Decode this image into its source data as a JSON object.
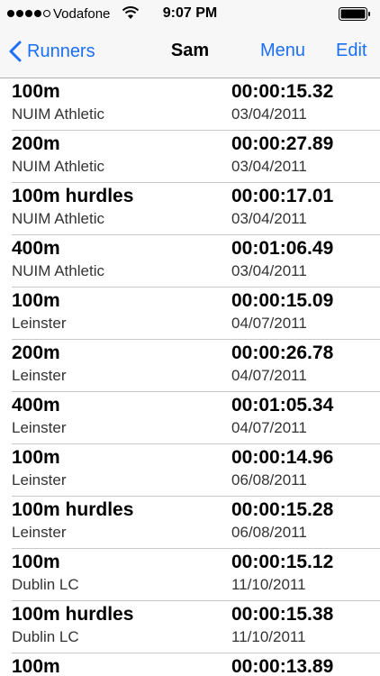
{
  "status_bar": {
    "carrier": "Vodafone",
    "time": "9:07 PM",
    "signal_bars_filled": 4,
    "signal_bars_total": 5
  },
  "nav": {
    "back_label": "Runners",
    "title": "Sam",
    "menu_label": "Menu",
    "edit_label": "Edit"
  },
  "colors": {
    "accent": "#1b6ff5",
    "bar_background": "#f7f7f7",
    "separator": "#c8c7cc"
  },
  "results": [
    {
      "event": "100m",
      "club": "NUIM Athletic",
      "time": "00:00:15.32",
      "date": "03/04/2011"
    },
    {
      "event": "200m",
      "club": "NUIM Athletic",
      "time": "00:00:27.89",
      "date": "03/04/2011"
    },
    {
      "event": "100m hurdles",
      "club": "NUIM Athletic",
      "time": "00:00:17.01",
      "date": "03/04/2011"
    },
    {
      "event": "400m",
      "club": "NUIM Athletic",
      "time": "00:01:06.49",
      "date": "03/04/2011"
    },
    {
      "event": "100m",
      "club": "Leinster",
      "time": "00:00:15.09",
      "date": "04/07/2011"
    },
    {
      "event": "200m",
      "club": "Leinster",
      "time": "00:00:26.78",
      "date": "04/07/2011"
    },
    {
      "event": "400m",
      "club": "Leinster",
      "time": "00:01:05.34",
      "date": "04/07/2011"
    },
    {
      "event": "100m",
      "club": "Leinster",
      "time": "00:00:14.96",
      "date": "06/08/2011"
    },
    {
      "event": "100m hurdles",
      "club": "Leinster",
      "time": "00:00:15.28",
      "date": "06/08/2011"
    },
    {
      "event": "100m",
      "club": "Dublin LC",
      "time": "00:00:15.12",
      "date": "11/10/2011"
    },
    {
      "event": "100m hurdles",
      "club": "Dublin LC",
      "time": "00:00:15.38",
      "date": "11/10/2011"
    },
    {
      "event": "100m",
      "club": "",
      "time": "00:00:13.89",
      "date": ""
    }
  ]
}
